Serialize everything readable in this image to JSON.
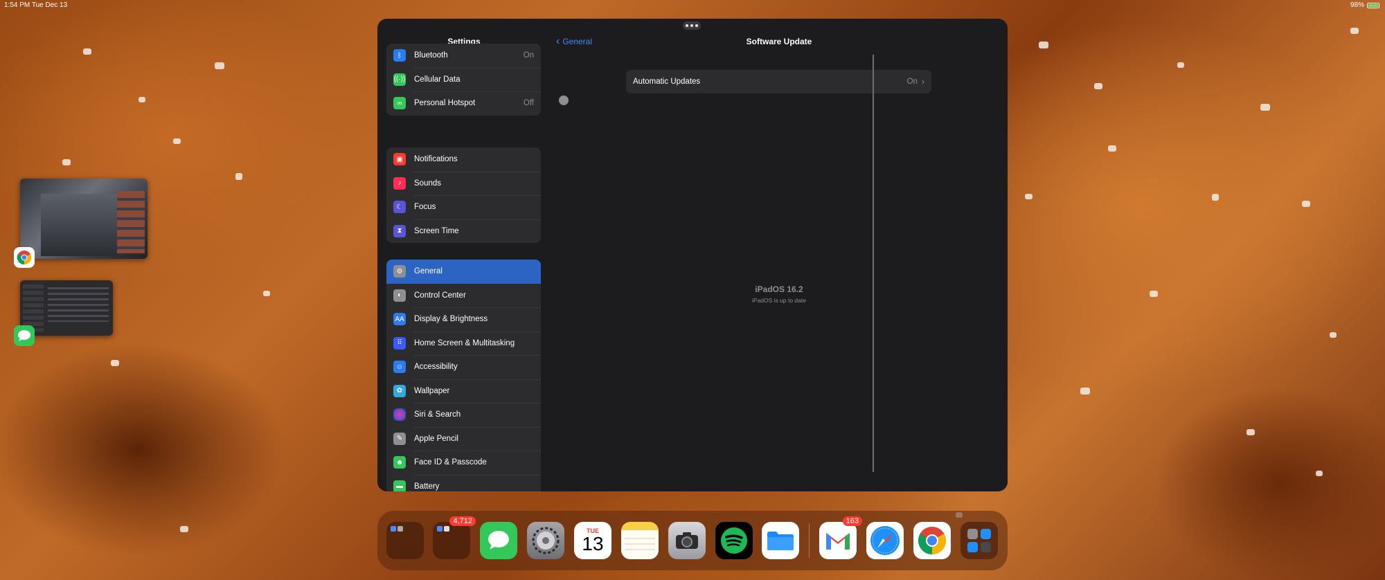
{
  "status_bar": {
    "time": "1:54 PM",
    "date": "Tue Dec 13",
    "battery": "98%"
  },
  "sidebar": {
    "title": "Settings",
    "groups": [
      {
        "items": [
          {
            "label": "Bluetooth",
            "value": "On",
            "icon": "bluetooth-icon",
            "color": "#2b7cf0"
          },
          {
            "label": "Cellular Data",
            "value": "",
            "icon": "cellular-icon",
            "color": "#34c759"
          },
          {
            "label": "Personal Hotspot",
            "value": "Off",
            "icon": "hotspot-icon",
            "color": "#34c759"
          }
        ]
      },
      {
        "items": [
          {
            "label": "Notifications",
            "icon": "notifications-icon",
            "color": "#ff3b30"
          },
          {
            "label": "Sounds",
            "icon": "sounds-icon",
            "color": "#ff2d55"
          },
          {
            "label": "Focus",
            "icon": "focus-icon",
            "color": "#5856d6"
          },
          {
            "label": "Screen Time",
            "icon": "screen-time-icon",
            "color": "#5856d6"
          }
        ]
      },
      {
        "items": [
          {
            "label": "General",
            "icon": "general-icon",
            "color": "#8e8e93",
            "selected": true
          },
          {
            "label": "Control Center",
            "icon": "control-center-icon",
            "color": "#8e8e93"
          },
          {
            "label": "Display & Brightness",
            "icon": "display-icon",
            "color": "#2b7cf0"
          },
          {
            "label": "Home Screen & Multitasking",
            "icon": "home-screen-icon",
            "color": "#3d5afe"
          },
          {
            "label": "Accessibility",
            "icon": "accessibility-icon",
            "color": "#2b7cf0"
          },
          {
            "label": "Wallpaper",
            "icon": "wallpaper-icon",
            "color": "#34aadc"
          },
          {
            "label": "Siri & Search",
            "icon": "siri-icon",
            "color": "#222"
          },
          {
            "label": "Apple Pencil",
            "icon": "pencil-icon",
            "color": "#8e8e93"
          },
          {
            "label": "Face ID & Passcode",
            "icon": "face-id-icon",
            "color": "#34c759"
          },
          {
            "label": "Battery",
            "icon": "battery-icon",
            "color": "#34c759"
          }
        ]
      }
    ]
  },
  "detail": {
    "back_label": "General",
    "title": "Software Update",
    "automatic_updates": {
      "label": "Automatic Updates",
      "value": "On"
    },
    "version_title": "iPadOS 16.2",
    "version_subtitle": "iPadOS is up to date"
  },
  "dock": {
    "apps": [
      {
        "name": "folder-1",
        "badge": ""
      },
      {
        "name": "folder-2",
        "badge": "4,712"
      },
      {
        "name": "messages",
        "badge": ""
      },
      {
        "name": "settings",
        "badge": ""
      },
      {
        "name": "calendar",
        "badge": "",
        "day": "TUE",
        "date": "13"
      },
      {
        "name": "notes",
        "badge": ""
      },
      {
        "name": "camera",
        "badge": ""
      },
      {
        "name": "spotify",
        "badge": ""
      },
      {
        "name": "files",
        "badge": ""
      },
      {
        "name": "gmail",
        "badge": "163"
      },
      {
        "name": "safari",
        "badge": ""
      },
      {
        "name": "chrome",
        "badge": ""
      },
      {
        "name": "app-library",
        "badge": ""
      }
    ]
  }
}
